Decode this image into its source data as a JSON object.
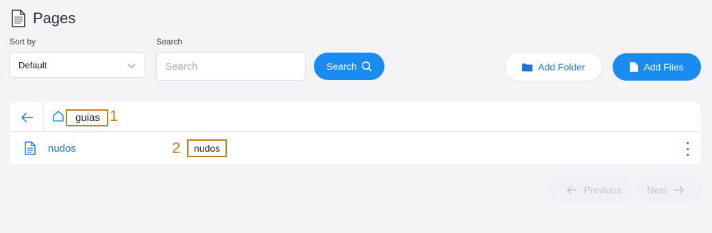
{
  "header": {
    "title": "Pages",
    "icon": "document-icon"
  },
  "sort": {
    "label": "Sort by",
    "value": "Default"
  },
  "search": {
    "label": "Search",
    "placeholder": "Search",
    "button_label": "Search"
  },
  "actions": {
    "add_folder": "Add Folder",
    "add_files": "Add Files"
  },
  "breadcrumb": {
    "current": "guias",
    "annotation": "1"
  },
  "files": [
    {
      "name": "nudos",
      "tag": "nudos",
      "annotation": "2"
    }
  ],
  "pagination": {
    "previous": "Previous",
    "next": "Next"
  },
  "colors": {
    "accent": "#1a8cf0",
    "link": "#1a75d6",
    "annotation": "#c57a1b",
    "background": "#f4f4f7"
  }
}
